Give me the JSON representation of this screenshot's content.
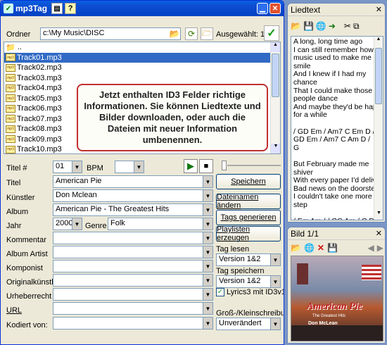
{
  "main": {
    "title": "mp3Tag",
    "folder_label": "Ordner",
    "folder_path": "c:\\My Music\\DISC",
    "selected_label": "Ausgewählt: 1",
    "parent_dir": "..",
    "files": [
      "Track01.mp3",
      "Track02.mp3",
      "Track03.mp3",
      "Track04.mp3",
      "Track05.mp3",
      "Track06.mp3",
      "Track07.mp3",
      "Track08.mp3",
      "Track09.mp3",
      "Track10.mp3"
    ],
    "overlay_text": "Jetzt enthalten ID3 Felder richtige Informationen. Sie können Liedtexte und Bilder downloaden, oder auch die Dateien mit neuer Information umbenennen.",
    "fields": {
      "titel_nr_label": "Titel #",
      "titel_nr": "01",
      "bpm_label": "BPM",
      "bpm": "",
      "titel_label": "Titel",
      "titel": "American Pie",
      "kuenstler_label": "Künstler",
      "kuenstler": "Don Mclean",
      "album_label": "Album",
      "album": "American Pie - The Greatest Hits",
      "jahr_label": "Jahr",
      "jahr": "2000",
      "genre_label": "Genre",
      "genre": "Folk",
      "kommentar_label": "Kommentar",
      "kommentar": "",
      "album_artist_label": "Album Artist",
      "album_artist": "",
      "komponist_label": "Komponist",
      "komponist": "",
      "originalkuenstler_label": "Originalkünstler",
      "originalkuenstler": "",
      "urheberrecht_label": "Urheberrecht",
      "urheberrecht": "",
      "url_label": "URL",
      "url": "",
      "kodiert_label": "Kodiert von:",
      "kodiert": ""
    },
    "buttons": {
      "speichern": "Speichern",
      "dateinamen": "Dateinamen ändern",
      "tags": "Tags generieren",
      "playlisten": "Playlisten erzeugen"
    },
    "tag_lesen_label": "Tag lesen",
    "tag_lesen_value": "Version 1&2",
    "tag_speichern_label": "Tag speichern",
    "tag_speichern_value": "Version 1&2",
    "lyrics_checkbox_label": "Lyrics3 mit ID3v1",
    "case_label": "Groß-/Kleinschreibung",
    "case_value": "Unverändert"
  },
  "lyrics": {
    "title": "Liedtext",
    "text": "A long, long time ago\nI can still remember how that\nmusic used to make me\nsmile\nAnd I knew if I had my\nchance\nThat I could make those\npeople dance\nAnd maybe they'd be happy\nfor a while\n\n/ GD Em / Am7 C Em D /\nGD Em / Am7 C Am D /\nG\n\nBut February made me\nshiver\nWith every paper I'd deliver\nBad news on the doorstep\nI couldn't take one more\nstep\n\n/ Em Am / / CG Am / C D /"
  },
  "image": {
    "title": "Bild 1/1",
    "cover_title": "American Pie",
    "cover_sub": "The Greatest Hits",
    "cover_artist": "Don McLean"
  }
}
